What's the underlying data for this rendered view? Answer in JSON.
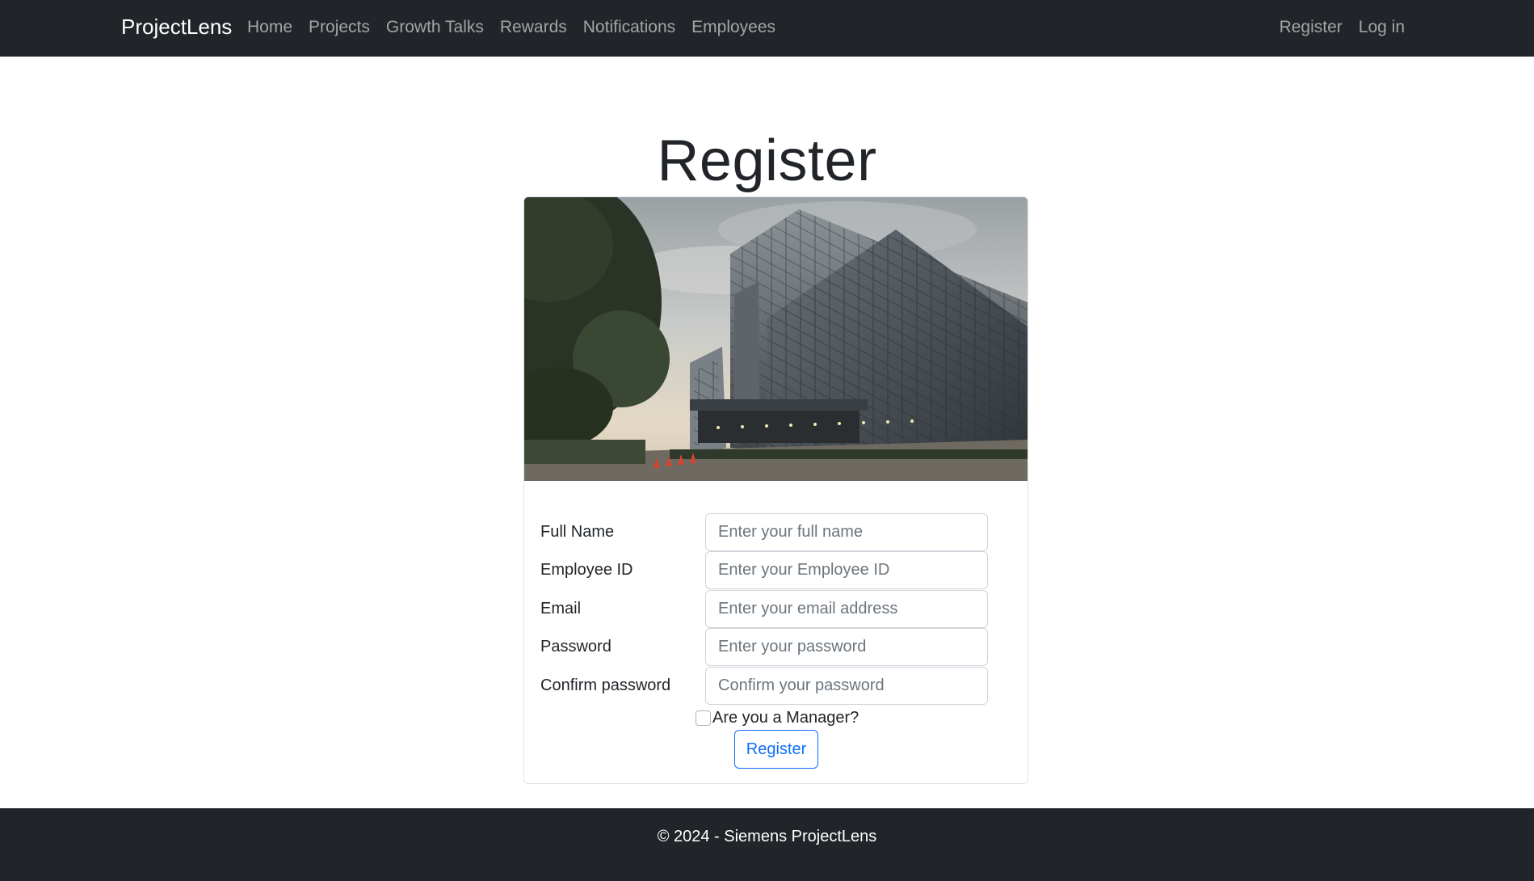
{
  "navbar": {
    "brand": "ProjectLens",
    "links": [
      "Home",
      "Projects",
      "Growth Talks",
      "Rewards",
      "Notifications",
      "Employees"
    ],
    "right_links": [
      "Register",
      "Log in"
    ]
  },
  "page": {
    "title": "Register"
  },
  "form": {
    "fields": [
      {
        "label": "Full Name",
        "placeholder": "Enter your full name",
        "value": ""
      },
      {
        "label": "Employee ID",
        "placeholder": "Enter your Employee ID",
        "value": ""
      },
      {
        "label": "Email",
        "placeholder": "Enter your email address",
        "value": ""
      },
      {
        "label": "Password",
        "placeholder": "Enter your password",
        "value": ""
      },
      {
        "label": "Confirm password",
        "placeholder": "Confirm your password",
        "value": ""
      }
    ],
    "manager_checkbox_label": "Are you a Manager?",
    "manager_checked": false,
    "submit_label": "Register"
  },
  "footer": {
    "text": "© 2024 - Siemens ProjectLens"
  },
  "colors": {
    "navbar_bg": "#212529",
    "primary": "#0d6efd",
    "nav_link": "rgba(255,255,255,0.58)"
  }
}
